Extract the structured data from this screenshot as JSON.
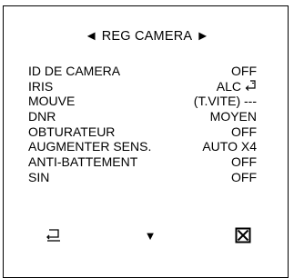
{
  "header": {
    "left_arrow": "◄",
    "title": "REG CAMERA",
    "right_arrow": "►"
  },
  "menu": [
    {
      "label": "ID DE CAMERA",
      "value": "OFF"
    },
    {
      "label": "IRIS",
      "value": "ALC",
      "icon": "enter-icon"
    },
    {
      "label": "MOUVE",
      "value": "(T.VITE) ---"
    },
    {
      "label": "DNR",
      "value": "MOYEN"
    },
    {
      "label": "OBTURATEUR",
      "value": "OFF"
    },
    {
      "label": "AUGMENTER SENS.",
      "value": "AUTO X4"
    },
    {
      "label": "ANTI-BATTEMENT",
      "value": "OFF"
    },
    {
      "label": "SIN",
      "value": "OFF"
    }
  ],
  "footer": {
    "back_icon": "return-icon",
    "down_glyph": "▼",
    "close_icon": "close-box-icon"
  }
}
